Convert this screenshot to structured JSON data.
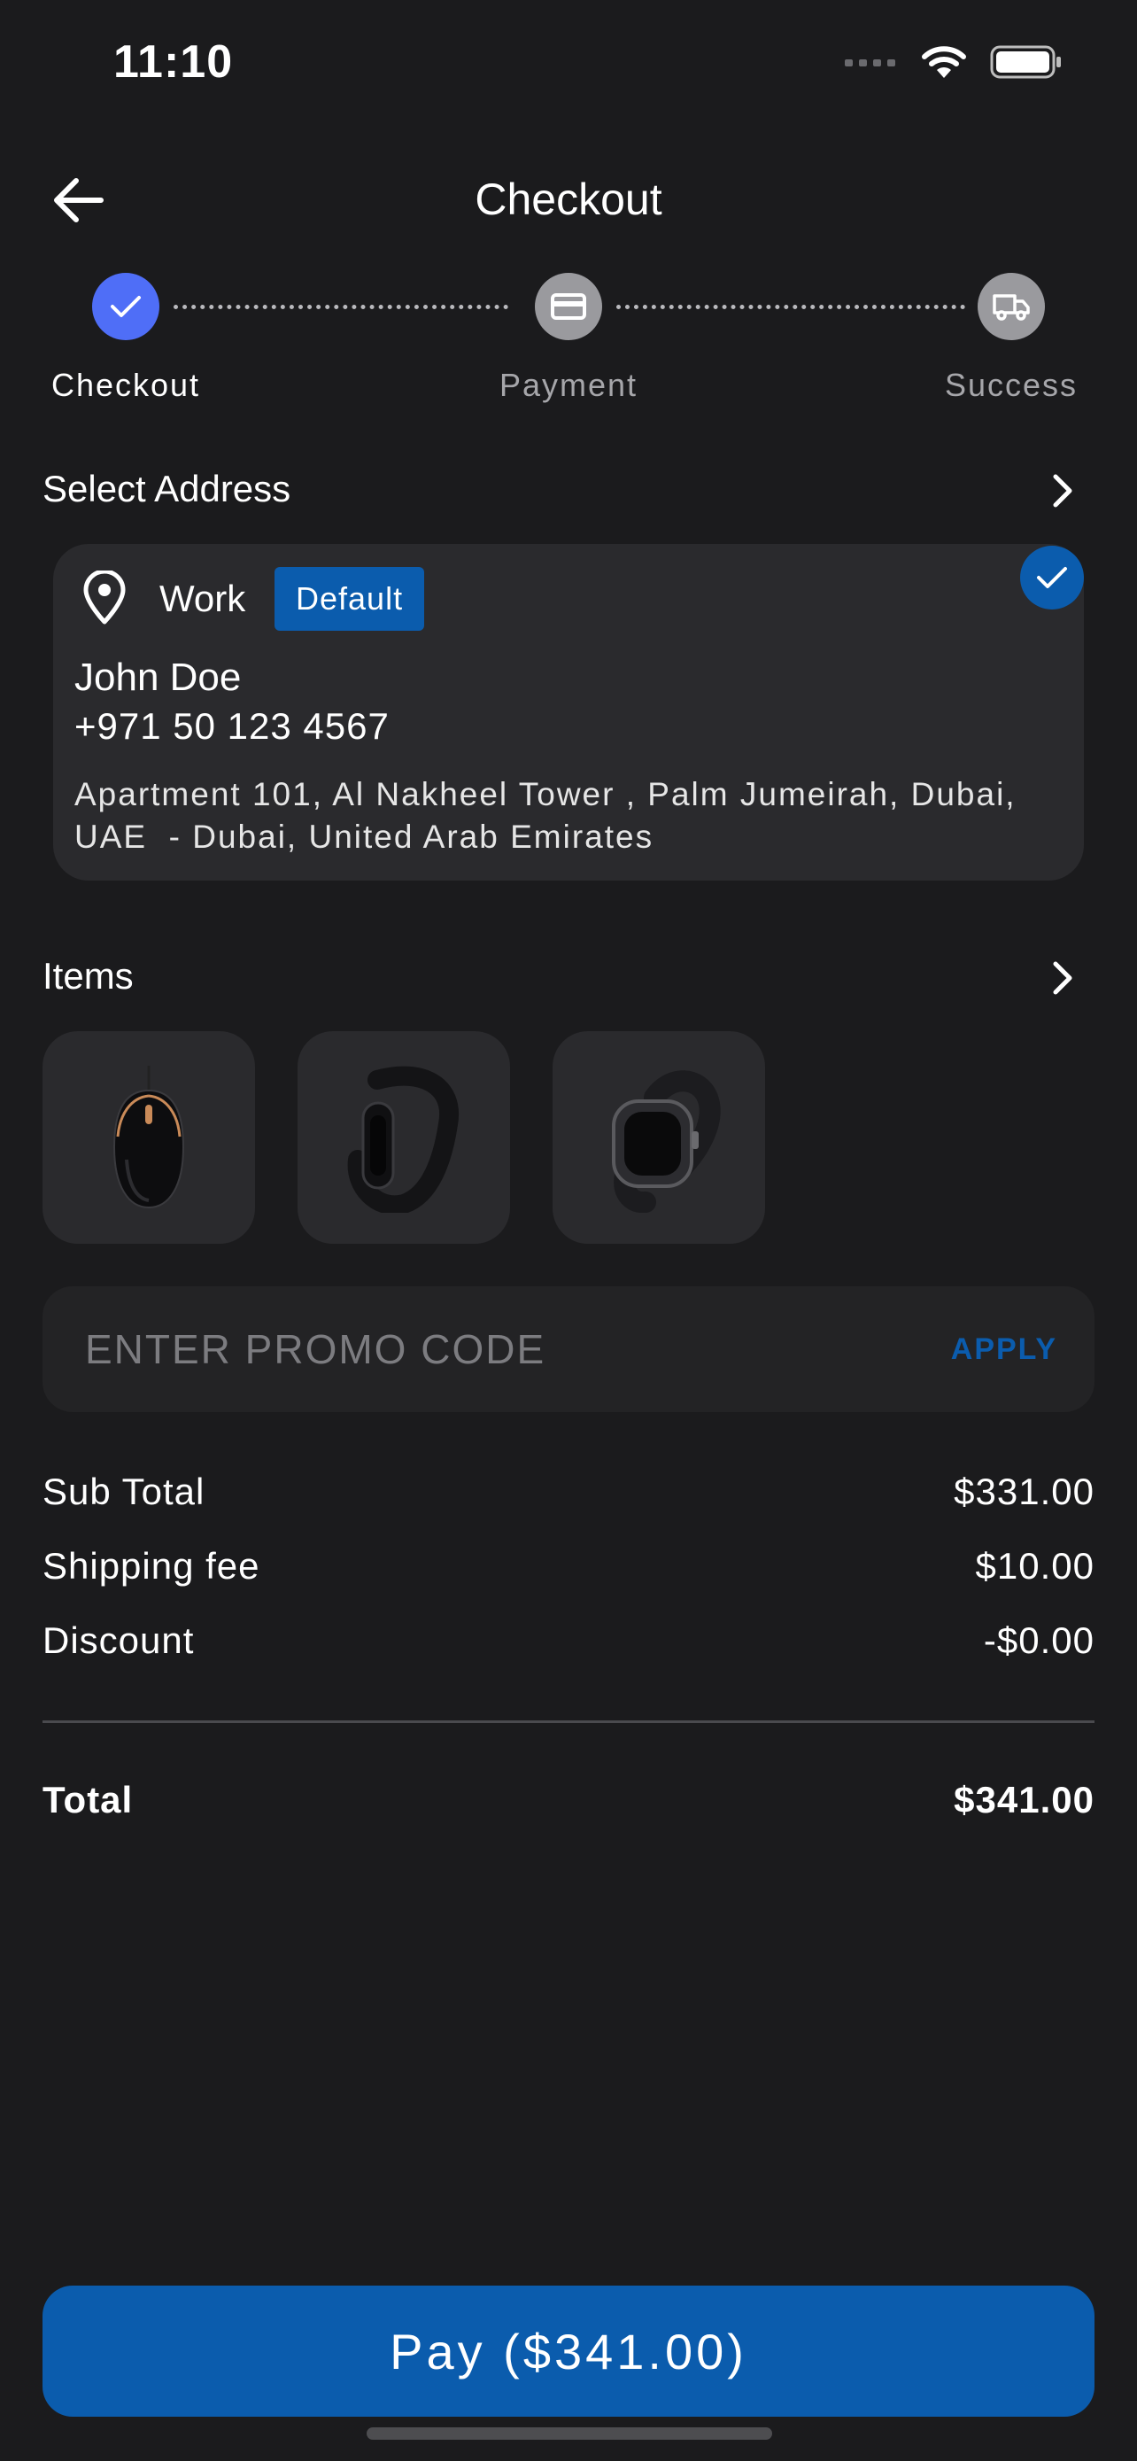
{
  "status_bar": {
    "time": "11:10"
  },
  "header": {
    "title": "Checkout"
  },
  "stepper": {
    "steps": [
      {
        "label": "Checkout",
        "state": "done"
      },
      {
        "label": "Payment",
        "state": "pending"
      },
      {
        "label": "Success",
        "state": "pending"
      }
    ]
  },
  "address_section": {
    "title": "Select Address",
    "card": {
      "type": "Work",
      "badge": "Default",
      "name": "John Doe",
      "phone": "+971 50 123 4567",
      "address_line1": "Apartment 101, Al Nakheel Tower , Palm Jumeirah, Dubai,",
      "address_line2": "UAE  - Dubai, United Arab Emirates",
      "selected": true
    }
  },
  "items_section": {
    "title": "Items",
    "items": [
      {
        "icon": "gaming-mouse-icon"
      },
      {
        "icon": "fitness-band-icon"
      },
      {
        "icon": "smartwatch-icon"
      }
    ]
  },
  "promo": {
    "placeholder": "ENTER PROMO CODE",
    "value": "",
    "apply_label": "APPLY"
  },
  "summary": {
    "subtotal_label": "Sub Total",
    "subtotal_value": "$331.00",
    "shipping_label": "Shipping fee",
    "shipping_value": "$10.00",
    "discount_label": "Discount",
    "discount_value": "-$0.00",
    "total_label": "Total",
    "total_value": "$341.00"
  },
  "pay_button": {
    "label": "Pay ($341.00)"
  },
  "colors": {
    "background": "#1b1b1d",
    "card": "#2a2a2d",
    "accent_blue": "#0b5cad",
    "step_done": "#4f6ef7",
    "step_pending": "#9a9a9e"
  }
}
